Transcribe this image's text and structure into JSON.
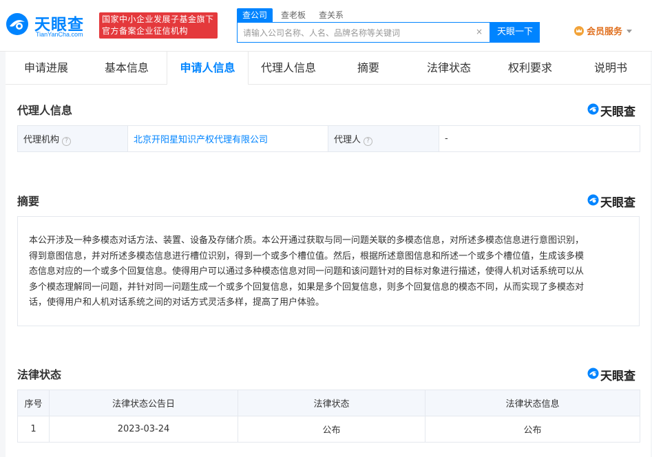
{
  "header": {
    "logo_cn": "天眼查",
    "logo_en": "TianYanCha.com",
    "badge_line1": "国家中小企业发展子基金旗下",
    "badge_line2": "官方备案企业征信机构",
    "search_tabs": [
      "查公司",
      "查老板",
      "查关系"
    ],
    "search_placeholder": "请输入公司名称、人名、品牌名称等关键词",
    "search_clear": "×",
    "search_button": "天眼一下",
    "vip_label": "会员服务"
  },
  "nav": {
    "items": [
      "申请进展",
      "基本信息",
      "申请人信息",
      "代理人信息",
      "摘要",
      "法律状态",
      "权利要求",
      "说明书"
    ],
    "active": "申请人信息"
  },
  "brand_mark": "天眼查",
  "agent_section": {
    "title": "代理人信息",
    "agency_label": "代理机构",
    "agency_value": "北京开阳星知识产权代理有限公司",
    "agent_label": "代理人",
    "agent_value": "-",
    "help_glyph": "?"
  },
  "abstract_section": {
    "title": "摘要",
    "lines": [
      "本公开涉及一种多模态对话方法、装置、设备及存储介质。本公开通过获取与同一问题关联的多模态信息，对所述多模态信息进行意图识别，",
      "得到意图信息，并对所述多模态信息进行槽位识别，得到一个或多个槽位值。然后，根据所述意图信息和所述一个或多个槽位值，生成该多模",
      "态信息对应的一个或多个回复信息。使得用户可以通过多种模态信息对同一问题和该问题针对的目标对象进行描述，使得人机对话系统可以从",
      "多个模态理解同一问题，并针对同一问题生成一个或多个回复信息，如果是多个回复信息，则多个回复信息的模态不同，从而实现了多模态对",
      "话，使得用户和人机对话系统之间的对话方式灵活多样，提高了用户体验。"
    ]
  },
  "legal_section": {
    "title": "法律状态",
    "columns": [
      "序号",
      "法律状态公告日",
      "法律状态",
      "法律状态信息"
    ],
    "rows": [
      [
        "1",
        "2023-03-24",
        "公布",
        "公布"
      ]
    ]
  },
  "colors": {
    "brand_blue": "#0084ff",
    "badge_red": "#e4393c",
    "vip_orange": "#e0701f"
  }
}
